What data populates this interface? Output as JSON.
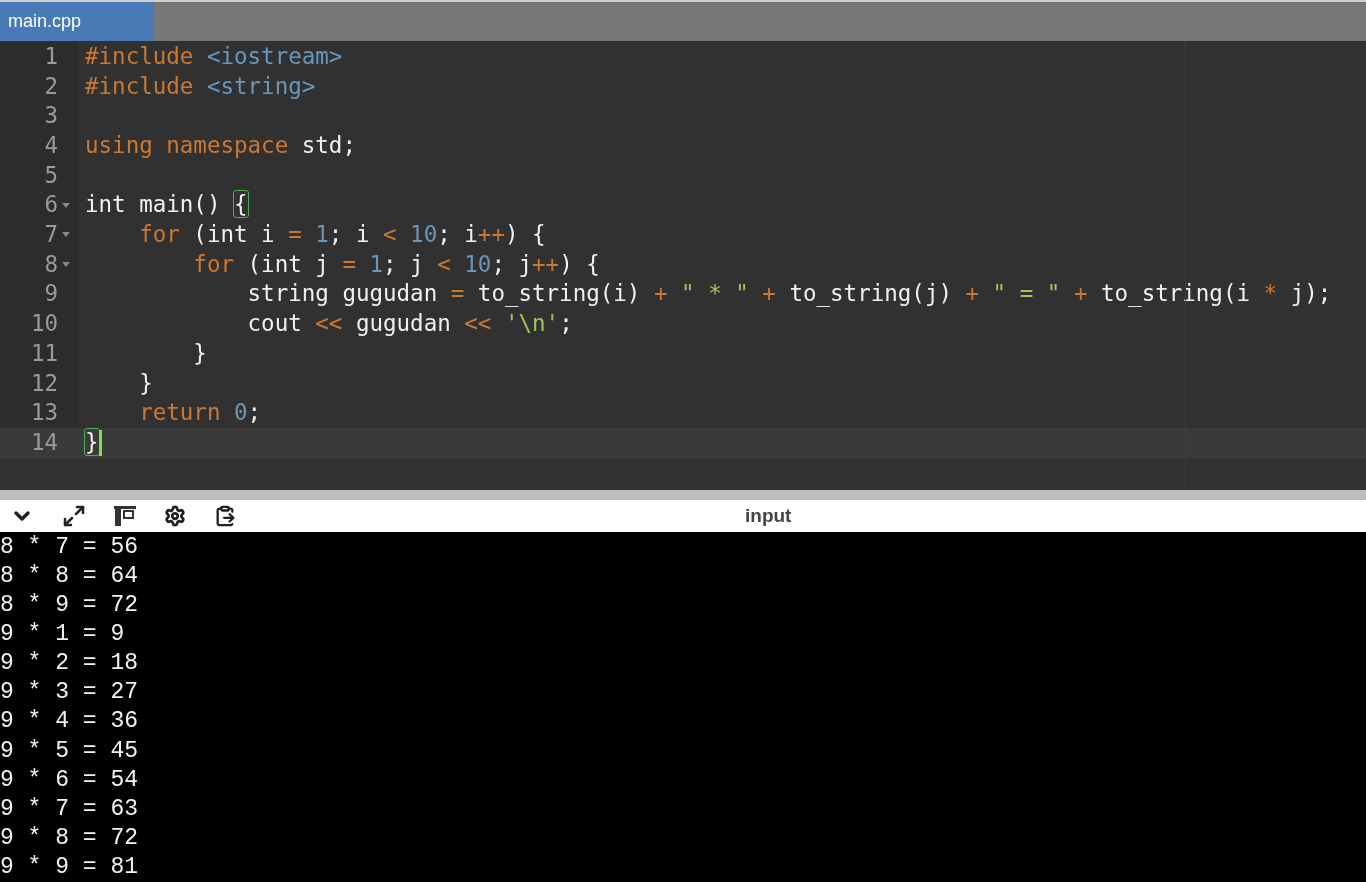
{
  "tabs": [
    {
      "label": "main.cpp",
      "selected": true
    }
  ],
  "editor": {
    "lines": [
      {
        "number": "1",
        "foldable": false,
        "active": false,
        "tokens": [
          {
            "kind": "kw",
            "text": "#include"
          },
          {
            "kind": "header",
            "text": " <iostream>"
          }
        ]
      },
      {
        "number": "2",
        "foldable": false,
        "active": false,
        "tokens": [
          {
            "kind": "kw",
            "text": "#include"
          },
          {
            "kind": "header",
            "text": " <string>"
          }
        ]
      },
      {
        "number": "3",
        "foldable": false,
        "active": false
      },
      {
        "number": "4",
        "foldable": false,
        "active": false,
        "tokens": [
          {
            "kind": "kw",
            "text": "using namespace"
          },
          {
            "kind": "plain",
            "text": " std;"
          }
        ]
      },
      {
        "number": "5",
        "foldable": false,
        "active": false
      },
      {
        "number": "6",
        "foldable": true,
        "active": false,
        "tokens": [
          {
            "kind": "plain",
            "text": "int main() "
          },
          {
            "kind": "bracket",
            "text": "{"
          }
        ]
      },
      {
        "number": "7",
        "foldable": true,
        "active": false,
        "tokens": [
          {
            "kind": "kw",
            "text": "    for"
          },
          {
            "kind": "plain",
            "text": " (int i "
          },
          {
            "kind": "op",
            "text": "="
          },
          {
            "kind": "num",
            "text": " 1"
          },
          {
            "kind": "plain",
            "text": "; i "
          },
          {
            "kind": "op",
            "text": "<"
          },
          {
            "kind": "num",
            "text": " 10"
          },
          {
            "kind": "plain",
            "text": "; i"
          },
          {
            "kind": "op",
            "text": "++"
          },
          {
            "kind": "plain",
            "text": ") {"
          }
        ]
      },
      {
        "number": "8",
        "foldable": true,
        "active": false,
        "tokens": [
          {
            "kind": "kw",
            "text": "        for"
          },
          {
            "kind": "plain",
            "text": " (int j "
          },
          {
            "kind": "op",
            "text": "="
          },
          {
            "kind": "num",
            "text": " 1"
          },
          {
            "kind": "plain",
            "text": "; j "
          },
          {
            "kind": "op",
            "text": "<"
          },
          {
            "kind": "num",
            "text": " 10"
          },
          {
            "kind": "plain",
            "text": "; j"
          },
          {
            "kind": "op",
            "text": "++"
          },
          {
            "kind": "plain",
            "text": ") {"
          }
        ]
      },
      {
        "number": "9",
        "foldable": false,
        "active": false,
        "tokens": [
          {
            "kind": "plain",
            "text": "            string gugudan "
          },
          {
            "kind": "op",
            "text": "="
          },
          {
            "kind": "plain",
            "text": " to_string(i) "
          },
          {
            "kind": "op",
            "text": "+"
          },
          {
            "kind": "lit",
            "text": " \" * \" "
          },
          {
            "kind": "op",
            "text": "+"
          },
          {
            "kind": "plain",
            "text": " to_string(j) "
          },
          {
            "kind": "op",
            "text": "+"
          },
          {
            "kind": "lit",
            "text": " \" = \" "
          },
          {
            "kind": "op",
            "text": "+"
          },
          {
            "kind": "plain",
            "text": " to_string(i "
          },
          {
            "kind": "op",
            "text": "*"
          },
          {
            "kind": "plain",
            "text": " j);"
          }
        ]
      },
      {
        "number": "10",
        "foldable": false,
        "active": false,
        "tokens": [
          {
            "kind": "plain",
            "text": "            cout "
          },
          {
            "kind": "op",
            "text": "<<"
          },
          {
            "kind": "plain",
            "text": " gugudan "
          },
          {
            "kind": "op",
            "text": "<<"
          },
          {
            "kind": "lit",
            "text": " '\\n'"
          },
          {
            "kind": "plain",
            "text": ";"
          }
        ]
      },
      {
        "number": "11",
        "foldable": false,
        "active": false,
        "tokens": [
          {
            "kind": "plain",
            "text": "        }"
          }
        ]
      },
      {
        "number": "12",
        "foldable": false,
        "active": false,
        "tokens": [
          {
            "kind": "plain",
            "text": "    }"
          }
        ]
      },
      {
        "number": "13",
        "foldable": false,
        "active": false,
        "tokens": [
          {
            "kind": "kw",
            "text": "    return"
          },
          {
            "kind": "num",
            "text": " 0"
          },
          {
            "kind": "plain",
            "text": ";"
          }
        ]
      },
      {
        "number": "14",
        "foldable": false,
        "active": true,
        "tokens": [
          {
            "kind": "bracket",
            "text": "}"
          }
        ]
      }
    ]
  },
  "panel": {
    "title": "input"
  },
  "output": [
    "8 * 7 = 56",
    "8 * 8 = 64",
    "8 * 9 = 72",
    "9 * 1 = 9",
    "9 * 2 = 18",
    "9 * 3 = 27",
    "9 * 4 = 36",
    "9 * 5 = 45",
    "9 * 6 = 54",
    "9 * 7 = 63",
    "9 * 8 = 72",
    "9 * 9 = 81"
  ]
}
